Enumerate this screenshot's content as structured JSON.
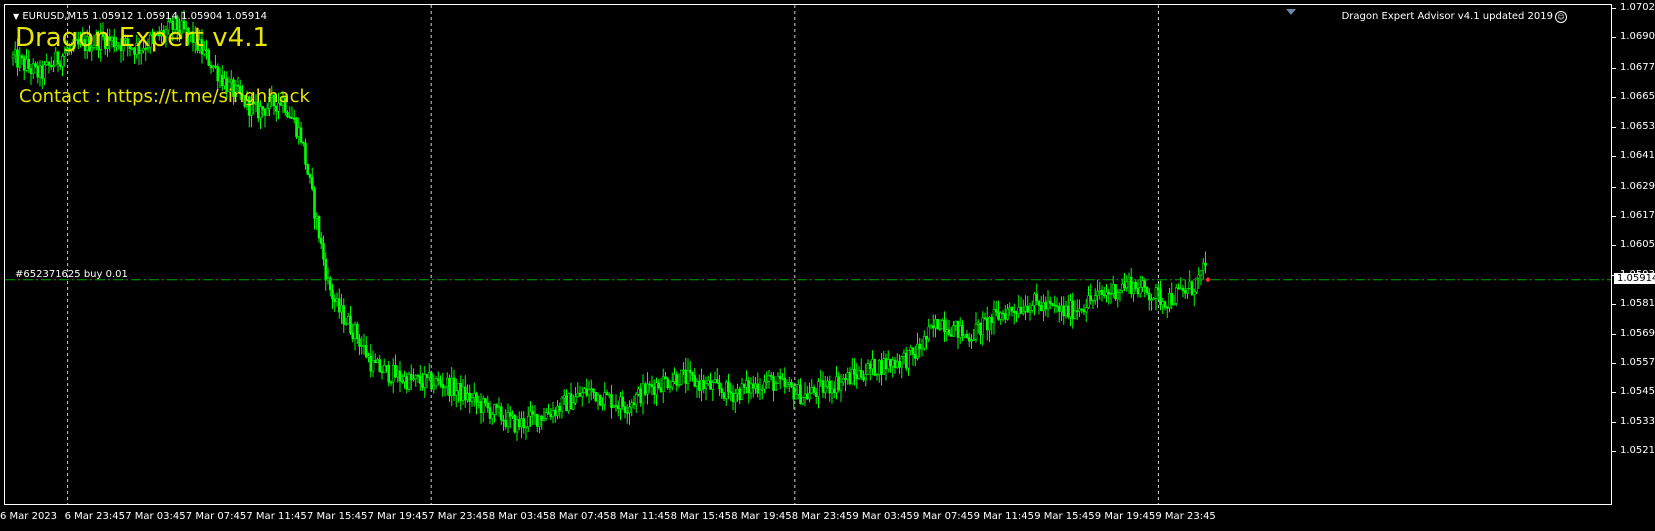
{
  "symbol_info": "EURUSD,M15  1.05912 1.05914 1.05904 1.05914",
  "ea_title": "Dragon Expert v4.1",
  "ea_contact": "Contact : https://t.me/singhhack",
  "ea_status": "Dragon Expert Advisor v4.1 updated 2019",
  "order_label": "#652371625 buy 0.01",
  "current_price": "1.05914",
  "colors": {
    "background": "#000000",
    "candle": "#00ff00",
    "text": "#ffffff",
    "ea_text": "#e6e600",
    "order_line": "#00aa00"
  },
  "icons": {
    "status": "smiley-icon",
    "chart_menu": "triangle-down-icon"
  },
  "price_axis": [
    "1.07020",
    "1.06900",
    "1.06775",
    "1.06655",
    "1.06535",
    "1.06415",
    "1.06290",
    "1.06170",
    "1.06050",
    "1.05930",
    "1.05810",
    "1.05690",
    "1.05570",
    "1.05450",
    "1.05330",
    "1.05210"
  ],
  "time_axis": [
    "6 Mar 2023",
    "6 Mar 23:45",
    "7 Mar 03:45",
    "7 Mar 07:45",
    "7 Mar 11:45",
    "7 Mar 15:45",
    "7 Mar 19:45",
    "7 Mar 23:45",
    "8 Mar 03:45",
    "8 Mar 07:45",
    "8 Mar 11:45",
    "8 Mar 15:45",
    "8 Mar 19:45",
    "8 Mar 23:45",
    "9 Mar 03:45",
    "9 Mar 07:45",
    "9 Mar 11:45",
    "9 Mar 15:45",
    "9 Mar 19:45",
    "9 Mar 23:45"
  ],
  "chart_data": {
    "type": "candlestick",
    "ylim": [
      1.0521,
      1.0702
    ],
    "day_separators": [
      "6 Mar 23:45",
      "7 Mar 23:45",
      "8 Mar 23:45",
      "9 Mar 23:45"
    ],
    "close_path": [
      [
        0,
        1.0682
      ],
      [
        3,
        1.0675
      ],
      [
        6,
        1.0685
      ],
      [
        10,
        1.069
      ],
      [
        14,
        1.0686
      ],
      [
        18,
        1.0695
      ],
      [
        20,
        1.069
      ],
      [
        22,
        1.068
      ],
      [
        24,
        1.067
      ],
      [
        27,
        1.066
      ],
      [
        30,
        1.0665
      ],
      [
        32,
        1.065
      ],
      [
        33,
        1.063
      ],
      [
        34,
        1.061
      ],
      [
        35,
        1.059
      ],
      [
        36,
        1.058
      ],
      [
        38,
        1.057
      ],
      [
        40,
        1.0556
      ],
      [
        44,
        1.055
      ],
      [
        48,
        1.0549
      ],
      [
        52,
        1.054
      ],
      [
        56,
        1.0532
      ],
      [
        60,
        1.0538
      ],
      [
        64,
        1.0546
      ],
      [
        68,
        1.054
      ],
      [
        71,
        1.0548
      ],
      [
        74,
        1.0552
      ],
      [
        77,
        1.0548
      ],
      [
        80,
        1.0545
      ],
      [
        84,
        1.055
      ],
      [
        88,
        1.0544
      ],
      [
        92,
        1.055
      ],
      [
        96,
        1.0556
      ],
      [
        100,
        1.056
      ],
      [
        103,
        1.0575
      ],
      [
        106,
        1.0568
      ],
      [
        110,
        1.0578
      ],
      [
        113,
        1.0582
      ],
      [
        117,
        1.0578
      ],
      [
        121,
        1.0585
      ],
      [
        124,
        1.059
      ],
      [
        128,
        1.0583
      ],
      [
        131,
        1.0588
      ],
      [
        133,
        1.0598
      ],
      [
        134,
        1.0592
      ]
    ],
    "total_bars": 134,
    "last_bar_index": 133
  }
}
